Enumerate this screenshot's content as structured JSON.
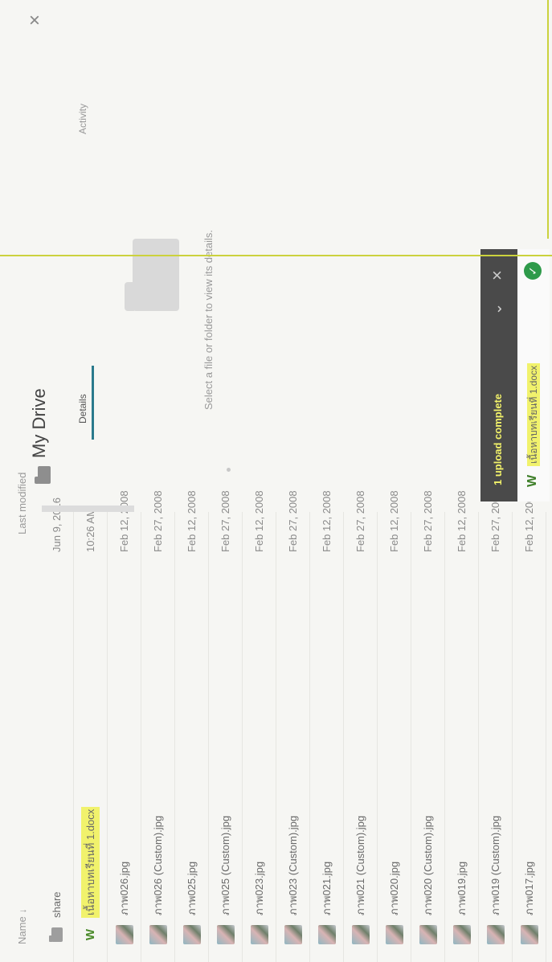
{
  "list": {
    "col_name": "Name",
    "col_modified": "Last modified",
    "rows": [
      {
        "name": "share",
        "modified": "Jun 9, 2016",
        "icon": "folder-icon"
      },
      {
        "name": "เนื้อหาบทเรียนที่ 1.docx",
        "modified": "10:26 AM",
        "icon": "word-icon"
      },
      {
        "name": "ภาพ026.jpg",
        "modified": "Feb 12, 2008",
        "icon": "image-thumbnail"
      },
      {
        "name": "ภาพ026 (Custom).jpg",
        "modified": "Feb 27, 2008",
        "icon": "image-thumbnail"
      },
      {
        "name": "ภาพ025.jpg",
        "modified": "Feb 12, 2008",
        "icon": "image-thumbnail"
      },
      {
        "name": "ภาพ025 (Custom).jpg",
        "modified": "Feb 27, 2008",
        "icon": "image-thumbnail"
      },
      {
        "name": "ภาพ023.jpg",
        "modified": "Feb 12, 2008",
        "icon": "image-thumbnail"
      },
      {
        "name": "ภาพ023 (Custom).jpg",
        "modified": "Feb 27, 2008",
        "icon": "image-thumbnail"
      },
      {
        "name": "ภาพ021.jpg",
        "modified": "Feb 12, 2008",
        "icon": "image-thumbnail"
      },
      {
        "name": "ภาพ021 (Custom).jpg",
        "modified": "Feb 27, 2008",
        "icon": "image-thumbnail"
      },
      {
        "name": "ภาพ020.jpg",
        "modified": "Feb 12, 2008",
        "icon": "image-thumbnail"
      },
      {
        "name": "ภาพ020 (Custom).jpg",
        "modified": "Feb 27, 2008",
        "icon": "image-thumbnail"
      },
      {
        "name": "ภาพ019.jpg",
        "modified": "Feb 12, 2008",
        "icon": "image-thumbnail"
      },
      {
        "name": "ภาพ019 (Custom).jpg",
        "modified": "Feb 27, 2008",
        "icon": "image-thumbnail"
      },
      {
        "name": "ภาพ017.jpg",
        "modified": "Feb 12, 2008",
        "icon": "image-thumbnail"
      }
    ]
  },
  "details": {
    "title": "My Drive",
    "tab_details": "Details",
    "tab_activity": "Activity",
    "hint": "Select a file or folder to view its details."
  },
  "upload": {
    "title": "1 upload complete",
    "file": "เนื้อหาบทเรียนที่ 1.docx"
  },
  "colors": {
    "highlight": "#f1f26c",
    "toast_bg": "#4a4a4a",
    "tab_accent": "#2b7a8c",
    "check": "#2e9a4a"
  }
}
